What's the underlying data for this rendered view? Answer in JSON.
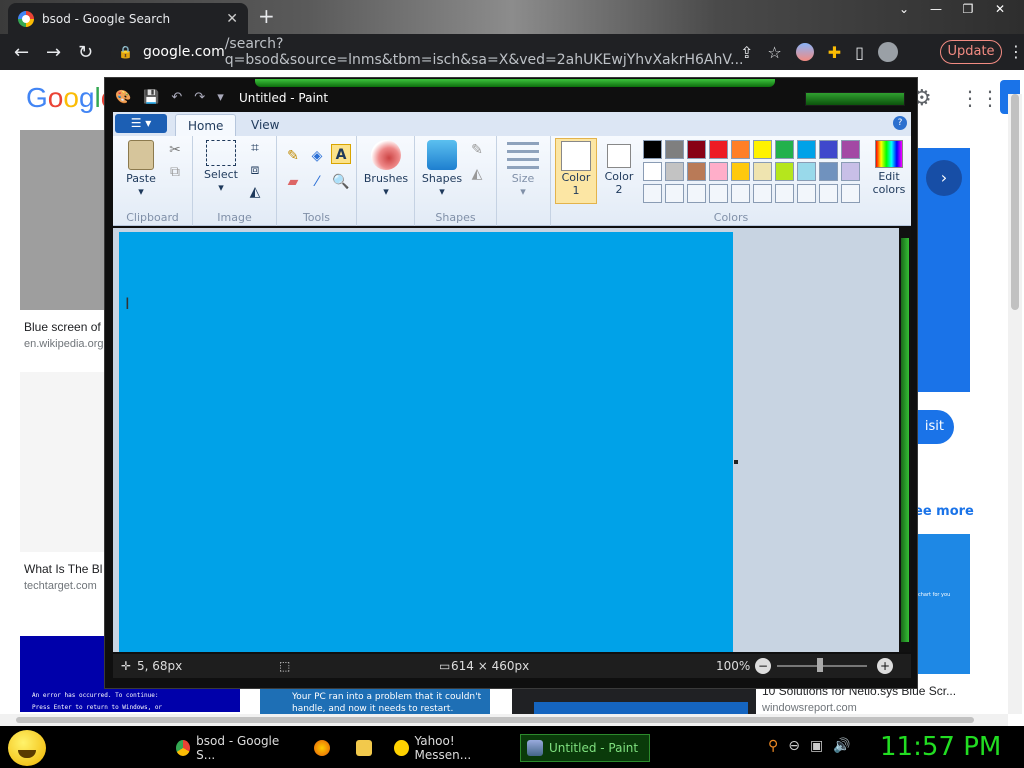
{
  "browser": {
    "tab_title": "bsod - Google Search",
    "tab_close": "✕",
    "new_tab": "+",
    "window_controls": [
      "⌄",
      "—",
      "❐",
      "✕"
    ],
    "nav": {
      "back": "←",
      "forward": "→",
      "reload": "↻"
    },
    "url_host": "google.com",
    "url_rest": "/search?q=bsod&source=lnms&tbm=isch&sa=X&ved=2ahUKEwjYhvXakrH6AhV...",
    "update_label": "Update",
    "menu": "⋮"
  },
  "google": {
    "logo_letters": [
      "G",
      "o",
      "o",
      "g",
      "l",
      "e"
    ],
    "results": [
      {
        "title": "Blue screen of",
        "source": "en.wikipedia.org"
      },
      {
        "title": "What Is The Bl",
        "source": "techtarget.com"
      }
    ],
    "visit_label": "isit",
    "see_more_label": "ee more",
    "bsod_thumb_line1": "An error has occurred. To continue:",
    "bsod_thumb_line2": "Press Enter to return to Windows, or",
    "pc_thumb_line1": "Your PC ran into a problem that it couldn't",
    "pc_thumb_line2": "handle, and now it needs to restart.",
    "bottom_title": "10 Solutions for Netio.sys Blue Scr...",
    "bottom_source": "windowsreport.com",
    "right_thumb_text": "chart for you"
  },
  "paint": {
    "title": "Untitled - Paint",
    "tabs": [
      "Home",
      "View"
    ],
    "groups": {
      "clipboard": "Clipboard",
      "image": "Image",
      "tools": "Tools",
      "shapes": "Shapes",
      "colors": "Colors"
    },
    "buttons": {
      "paste": "Paste",
      "select": "Select",
      "brushes": "Brushes",
      "shapes": "Shapes",
      "size": "Size",
      "color1_a": "Color",
      "color1_b": "1",
      "color2_a": "Color",
      "color2_b": "2",
      "edit_colors_a": "Edit",
      "edit_colors_b": "colors"
    },
    "palette_row1": [
      "#000000",
      "#7f7f7f",
      "#880015",
      "#ed1c24",
      "#ff7f27",
      "#fff200",
      "#22b14c",
      "#00a2e8",
      "#3f48cc",
      "#a349a4"
    ],
    "palette_row2": [
      "#ffffff",
      "#c3c3c3",
      "#b97a57",
      "#ffaec9",
      "#ffc90e",
      "#efe4b0",
      "#b5e61d",
      "#99d9ea",
      "#7092be",
      "#c8bfe7"
    ],
    "canvas_color": "#00a2e8",
    "status": {
      "cursor_pos": "5, 68px",
      "canvas_size": "614 × 460px",
      "zoom": "100%"
    }
  },
  "taskbar": {
    "tasks": [
      "bsod - Google S...",
      "",
      "",
      "Yahoo! Messen...",
      "Untitled - Paint"
    ],
    "clock": "11:57 PM"
  }
}
